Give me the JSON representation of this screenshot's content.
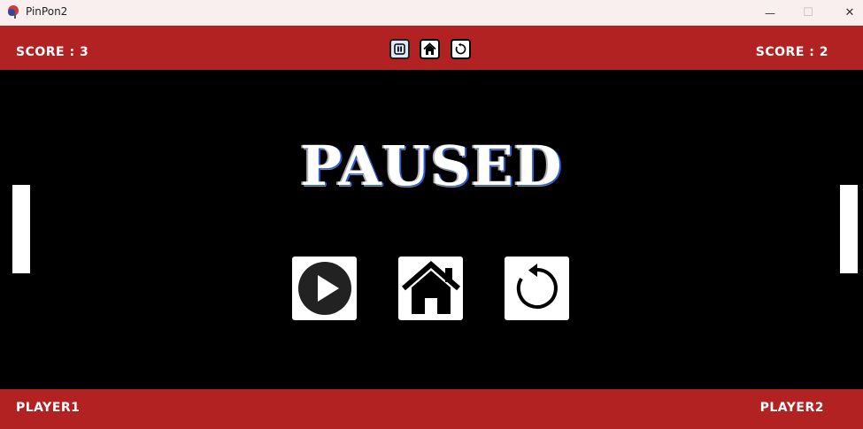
{
  "window": {
    "title": "PinPon2",
    "minimize_glyph": "—",
    "maximize_glyph": "☐",
    "close_glyph": "✕"
  },
  "scoreboard": {
    "left_score": "SCORE : 3",
    "right_score": "SCORE : 2"
  },
  "controls": {
    "pause": "pause-icon",
    "home": "home-icon",
    "restart": "restart-icon"
  },
  "pause_menu": {
    "title": "PAUSED",
    "buttons": [
      "play-icon",
      "home-icon",
      "restart-icon"
    ]
  },
  "players": {
    "left": "PLAYER1",
    "right": "PLAYER2"
  },
  "colors": {
    "bar": "#b22222",
    "field": "#000000",
    "paddle": "#ffffff"
  }
}
